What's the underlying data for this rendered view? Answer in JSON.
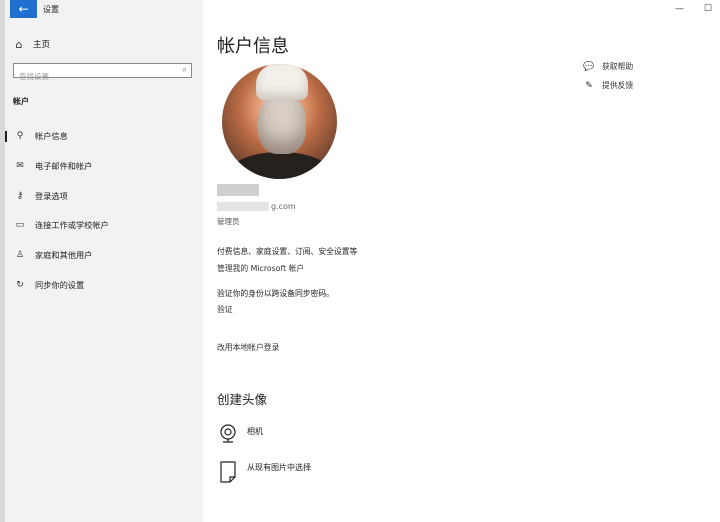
{
  "window": {
    "title": "设置",
    "minimize_glyph": "—",
    "maximize_glyph": "☐"
  },
  "sidebar": {
    "back_glyph": "←",
    "home_label": "主页",
    "search_placeholder": "查找设置",
    "section_title": "帐户",
    "items": [
      {
        "label": "帐户信息",
        "icon": "person-card-icon"
      },
      {
        "label": "电子邮件和帐户",
        "icon": "mail-icon"
      },
      {
        "label": "登录选项",
        "icon": "key-icon"
      },
      {
        "label": "连接工作或学校帐户",
        "icon": "briefcase-icon"
      },
      {
        "label": "家庭和其他用户",
        "icon": "person-add-icon"
      },
      {
        "label": "同步你的设置",
        "icon": "sync-icon"
      }
    ]
  },
  "main": {
    "title": "帐户信息",
    "email_suffix": "g.com",
    "role": "管理员",
    "billing_text": "付费信息、家庭设置、订阅、安全设置等",
    "manage_link": "管理我的 Microsoft 帐户",
    "verify_text": "验证你的身份以跨设备同步密码。",
    "verify_link": "验证",
    "local_login_link": "改用本地帐户登录",
    "create_avatar_title": "创建头像",
    "camera_label": "相机",
    "browse_label": "从现有图片中选择"
  },
  "help": {
    "get_help": "获取帮助",
    "give_feedback": "提供反馈"
  }
}
